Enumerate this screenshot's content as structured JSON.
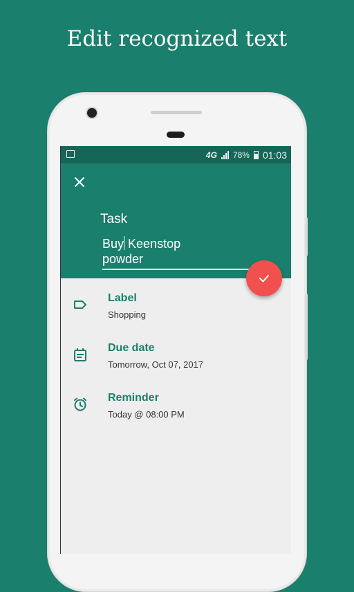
{
  "headline": "Edit recognized text",
  "status_bar": {
    "network": "4G",
    "battery": "78%",
    "time": "01:03"
  },
  "editor": {
    "field_label": "Task",
    "text_before_cursor": "Buy",
    "text_after_cursor": " Keenstop\npowder"
  },
  "details": [
    {
      "title": "Label",
      "value": "Shopping",
      "icon": "label-tag-icon"
    },
    {
      "title": "Due date",
      "value": "Tomorrow, Oct 07, 2017",
      "icon": "calendar-icon"
    },
    {
      "title": "Reminder",
      "value": "Today @ 08:00 PM",
      "icon": "alarm-clock-icon"
    }
  ],
  "colors": {
    "background": "#1a7f6c",
    "statusbar": "#156657",
    "accent_fab": "#f1504e",
    "title_text": "#1a7f6c"
  }
}
